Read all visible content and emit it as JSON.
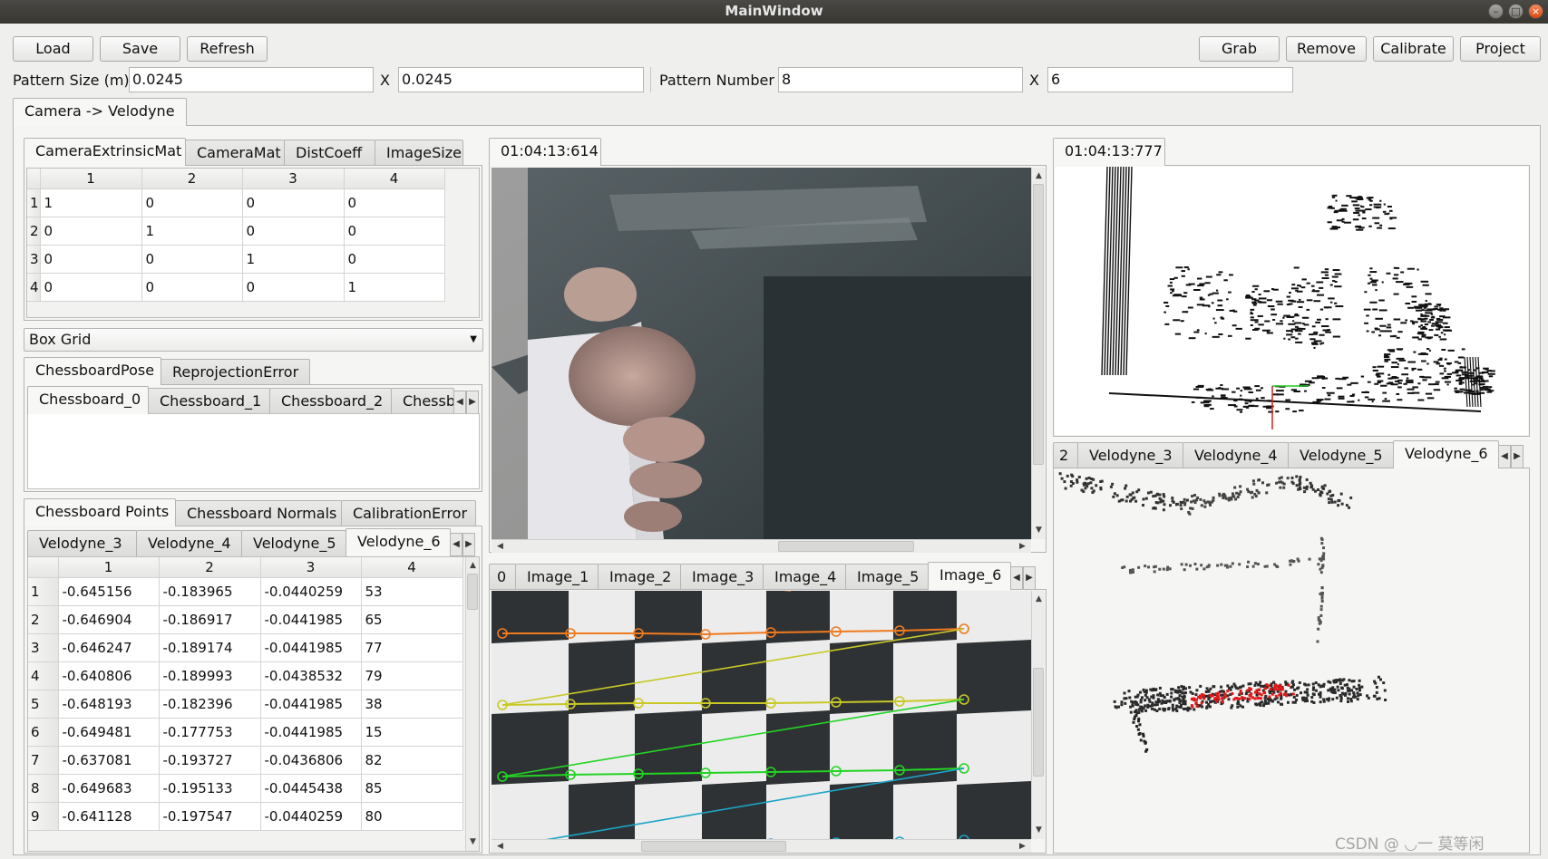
{
  "window": {
    "title": "MainWindow"
  },
  "toolbar": {
    "load": "Load",
    "save": "Save",
    "refresh": "Refresh",
    "grab": "Grab",
    "remove": "Remove",
    "calibrate": "Calibrate",
    "project": "Project"
  },
  "pattern": {
    "size_label": "Pattern Size (m)",
    "size_x": "0.0245",
    "x1": "X",
    "size_y": "0.0245",
    "number_label": "Pattern Number",
    "num_x": "8",
    "x2": "X",
    "num_y": "6"
  },
  "main_tab": "Camera -> Velodyne",
  "matrix_tabs": [
    "CameraExtrinsicMat",
    "CameraMat",
    "DistCoeff",
    "ImageSize"
  ],
  "matrix": {
    "cols": [
      "1",
      "2",
      "3",
      "4"
    ],
    "rows": [
      [
        "1",
        "1",
        "0",
        "0",
        "0"
      ],
      [
        "2",
        "0",
        "1",
        "0",
        "0"
      ],
      [
        "3",
        "0",
        "0",
        "1",
        "0"
      ],
      [
        "4",
        "0",
        "0",
        "0",
        "1"
      ]
    ]
  },
  "box_grid": "Box Grid",
  "pose_tabs": [
    "ChessboardPose",
    "ReprojectionError"
  ],
  "chessboard_tabs": [
    "Chessboard_0",
    "Chessboard_1",
    "Chessboard_2",
    "Chessb"
  ],
  "points_tabs": [
    "Chessboard Points",
    "Chessboard Normals",
    "CalibrationError"
  ],
  "velo_tabs_left": [
    "Velodyne_3",
    "Velodyne_4",
    "Velodyne_5",
    "Velodyne_6"
  ],
  "points": {
    "cols": [
      "1",
      "2",
      "3",
      "4"
    ],
    "rows": [
      [
        "1",
        "-0.645156",
        "-0.183965",
        "-0.0440259",
        "53"
      ],
      [
        "2",
        "-0.646904",
        "-0.186917",
        "-0.0441985",
        "65"
      ],
      [
        "3",
        "-0.646247",
        "-0.189174",
        "-0.0441985",
        "77"
      ],
      [
        "4",
        "-0.640806",
        "-0.189993",
        "-0.0438532",
        "79"
      ],
      [
        "5",
        "-0.648193",
        "-0.182396",
        "-0.0441985",
        "38"
      ],
      [
        "6",
        "-0.649481",
        "-0.177753",
        "-0.0441985",
        "15"
      ],
      [
        "7",
        "-0.637081",
        "-0.193727",
        "-0.0436806",
        "82"
      ],
      [
        "8",
        "-0.649683",
        "-0.195133",
        "-0.0445438",
        "85"
      ],
      [
        "9",
        "-0.641128",
        "-0.197547",
        "-0.0440259",
        "80"
      ]
    ]
  },
  "camera_timestamp": "01:04:13:614",
  "image_tabs": [
    "0",
    "Image_1",
    "Image_2",
    "Image_3",
    "Image_4",
    "Image_5",
    "Image_6"
  ],
  "lidar_timestamp": "01:04:13:777",
  "velo_tabs_right": [
    "2",
    "Velodyne_3",
    "Velodyne_4",
    "Velodyne_5",
    "Velodyne_6"
  ],
  "watermark": "CSDN @ ◡一 莫等闲"
}
